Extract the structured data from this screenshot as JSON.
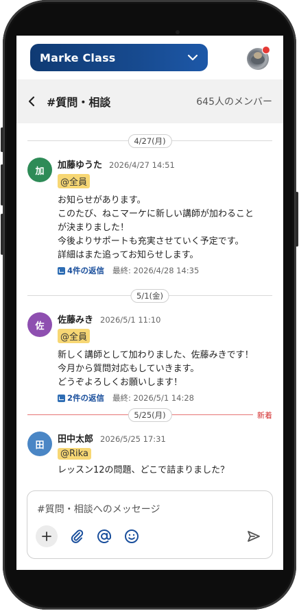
{
  "header": {
    "class_name": "Marke Class"
  },
  "channel": {
    "name": "#質問・相談",
    "member_count": "645人のメンバー"
  },
  "dates": [
    "4/27(月)",
    "5/1(金)",
    "5/25(月)"
  ],
  "new_label": "新着",
  "messages": [
    {
      "avatar_char": "加",
      "avatar_color": "#2e8b57",
      "name": "加藤ゆうた",
      "time": "2026/4/27 14:51",
      "mention": "@全員",
      "text": "お知らせがあります。\nこのたび、ねこマーケに新しい講師が加わること\nが決まりました！\n今後よりサポートも充実させていく予定です。\n詳細はまた追ってお知らせします。",
      "replies": "4件の返信",
      "last_reply": "最終: 2026/4/28 14:35"
    },
    {
      "avatar_char": "佐",
      "avatar_color": "#8e4fb0",
      "name": "佐藤みき",
      "time": "2026/5/1 11:10",
      "mention": "@全員",
      "text": "新しく講師として加わりました、佐藤みきです！\n今月から質問対応もしていきます。\nどうぞよろしくお願いします！",
      "replies": "2件の返信",
      "last_reply": "最終: 2026/5/1 14:28"
    },
    {
      "avatar_char": "田",
      "avatar_color": "#4a86c5",
      "name": "田中太郎",
      "time": "2026/5/25 17:31",
      "mention": "@Rika",
      "text": "レッスン12の問題、どこで詰まりました？"
    }
  ],
  "composer": {
    "placeholder": "#質問・相談へのメッセージ"
  },
  "icons": [
    "chevron-down-icon",
    "back-icon",
    "plus-icon",
    "paperclip-icon",
    "at-icon",
    "emoji-icon",
    "send-icon"
  ]
}
